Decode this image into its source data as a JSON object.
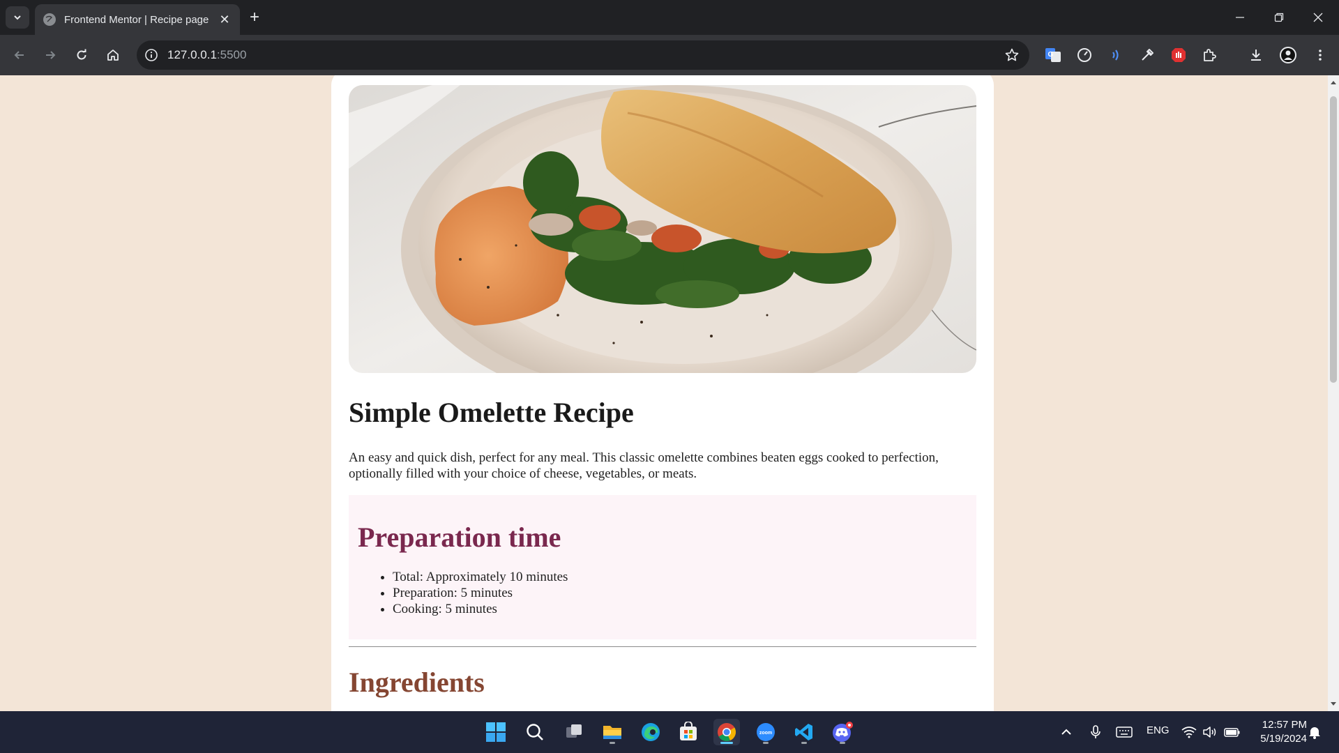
{
  "browser": {
    "tab_title": "Frontend Mentor | Recipe page",
    "url_host": "127.0.0.1",
    "url_port": ":5500"
  },
  "page": {
    "title": "Simple Omelette Recipe",
    "intro": "An easy and quick dish, perfect for any meal. This classic omelette combines beaten eggs cooked to perfection, optionally filled with your choice of cheese, vegetables, or meats.",
    "prep": {
      "heading": "Preparation time",
      "items": [
        "Total: Approximately 10 minutes",
        "Preparation: 5 minutes",
        "Cooking: 5 minutes"
      ]
    },
    "ingredients_heading": "Ingredients"
  },
  "taskbar": {
    "language": "ENG",
    "time": "12:57 PM",
    "date": "5/19/2024",
    "apps": [
      "start-icon",
      "search-icon",
      "task-view-icon",
      "file-explorer-icon",
      "edge-icon",
      "store-icon",
      "chrome-icon",
      "zoom-icon",
      "vscode-icon",
      "discord-icon"
    ]
  },
  "colors": {
    "page_background": "#f3e5d7",
    "card_background": "#ffffff",
    "prep_background": "#fdf4f8",
    "prep_heading": "#7a284e",
    "ingredients_heading": "#854632"
  }
}
